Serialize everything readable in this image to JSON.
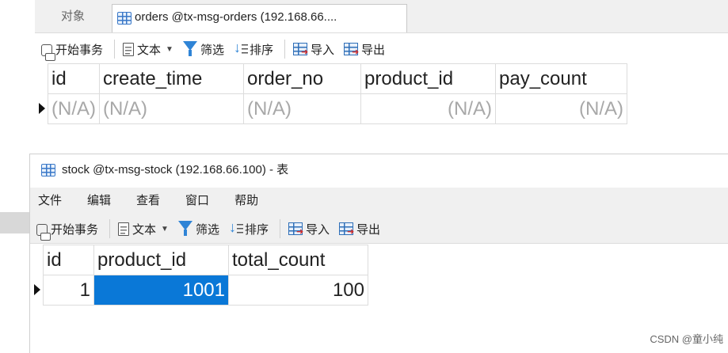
{
  "top": {
    "tab_objects": "对象",
    "tab_orders": "orders @tx-msg-orders (192.168.66....",
    "toolbar": {
      "begin_transaction": "开始事务",
      "text": "文本",
      "filter": "筛选",
      "sort": "排序",
      "import": "导入",
      "export": "导出"
    },
    "columns": [
      "id",
      "create_time",
      "order_no",
      "product_id",
      "pay_count"
    ],
    "row": [
      "(N/A)",
      "(N/A)",
      "(N/A)",
      "(N/A)",
      "(N/A)"
    ]
  },
  "stock": {
    "title": "stock @tx-msg-stock (192.168.66.100) - 表",
    "menu": [
      "文件",
      "编辑",
      "查看",
      "窗口",
      "帮助"
    ],
    "toolbar": {
      "begin_transaction": "开始事务",
      "text": "文本",
      "filter": "筛选",
      "sort": "排序",
      "import": "导入",
      "export": "导出"
    },
    "columns": [
      "id",
      "product_id",
      "total_count"
    ],
    "row": [
      "1",
      "1001",
      "100"
    ]
  },
  "watermark": "CSDN @童小纯",
  "colors": {
    "selection": "#0a78d7",
    "accent": "#2f84d6"
  }
}
